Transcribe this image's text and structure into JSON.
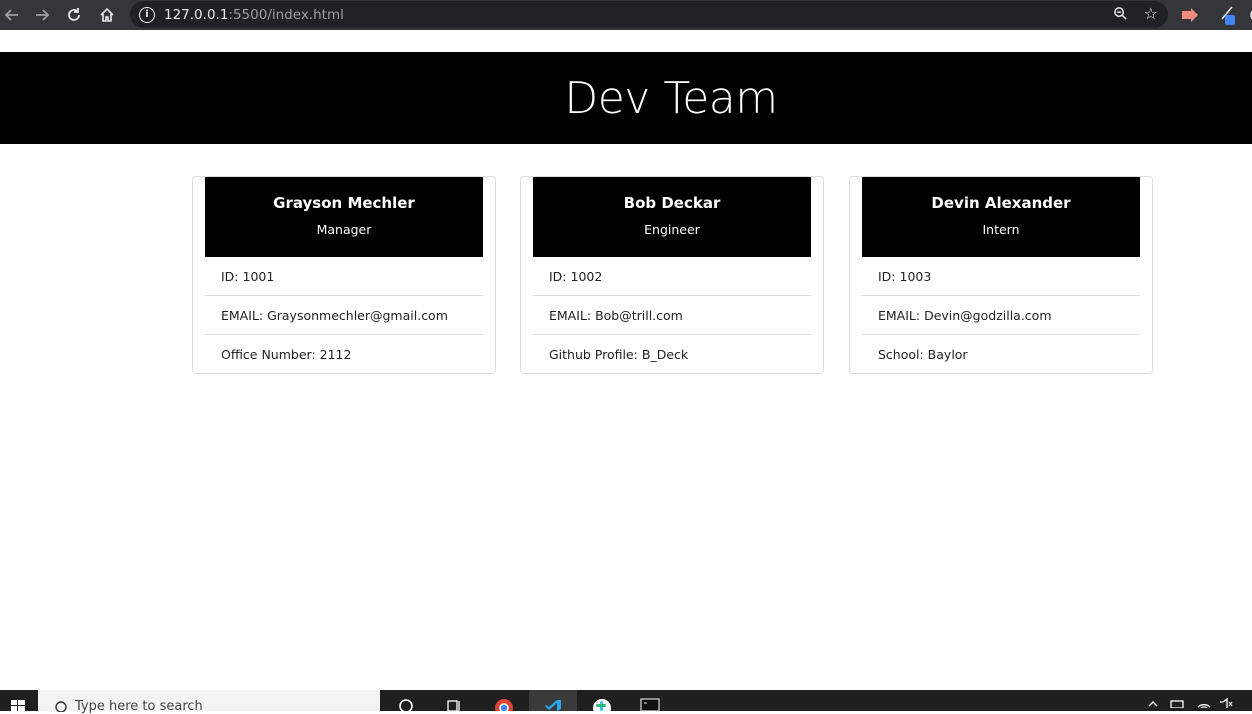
{
  "browser": {
    "url_host": "127.0.0.1",
    "url_path": ":5500/index.html"
  },
  "page": {
    "title": "Dev Team"
  },
  "cards": [
    {
      "name": "Grayson Mechler",
      "role": "Manager",
      "id": "ID: 1001",
      "email": "EMAIL: Graysonmechler@gmail.com",
      "extra": "Office Number: 2112"
    },
    {
      "name": "Bob Deckar",
      "role": "Engineer",
      "id": "ID: 1002",
      "email": "EMAIL: Bob@trill.com",
      "extra": "Github Profile: B_Deck"
    },
    {
      "name": "Devin Alexander",
      "role": "Intern",
      "id": "ID: 1003",
      "email": "EMAIL: Devin@godzilla.com",
      "extra": "School: Baylor"
    }
  ],
  "taskbar": {
    "search_placeholder": "Type here to search"
  },
  "colors": {
    "header_bg": "#000000",
    "chrome_bg": "#35363a",
    "omnibox_bg": "#202124"
  }
}
